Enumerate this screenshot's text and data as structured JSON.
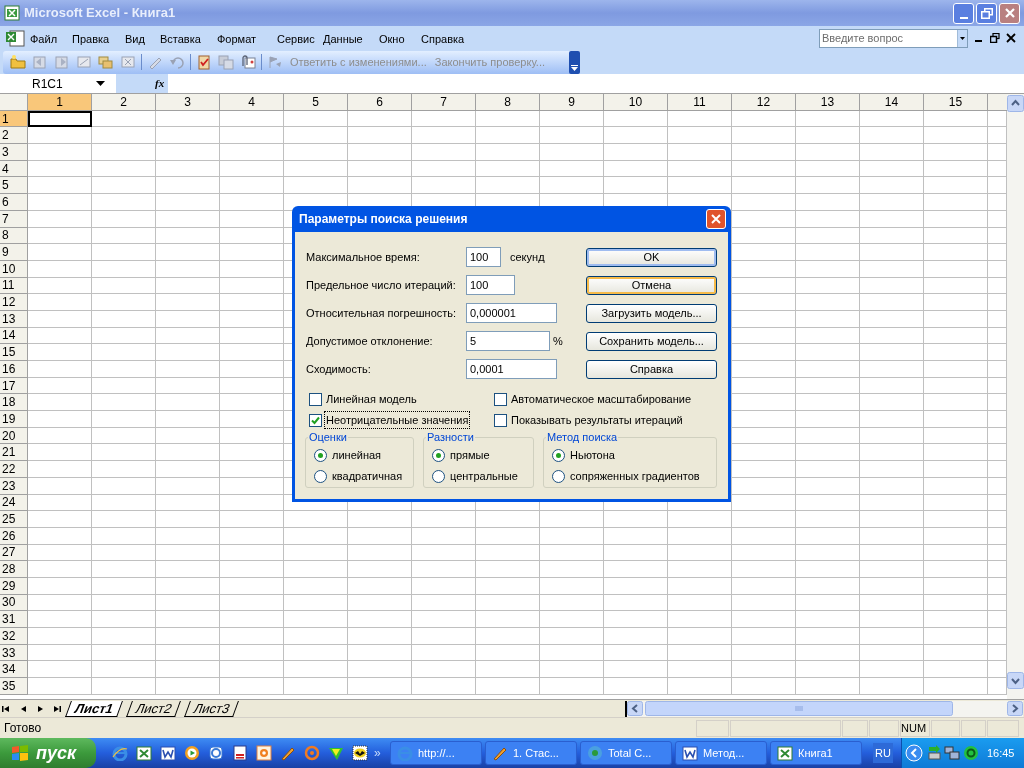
{
  "window": {
    "title": "Microsoft Excel - Книга1"
  },
  "menu": [
    "Файл",
    "Правка",
    "Вид",
    "Вставка",
    "Формат",
    "Сервис",
    "Данные",
    "Окно",
    "Справка"
  ],
  "help_search": {
    "placeholder": "Введите вопрос"
  },
  "toolbar": {
    "buttons": [
      {
        "label": "Ответить с изменениями...",
        "disabled": true
      },
      {
        "label": "Закончить проверку...",
        "disabled": true
      }
    ]
  },
  "name_box": {
    "value": "R1C1"
  },
  "formula_bar": {
    "function_label": "fx"
  },
  "columns": [
    {
      "label": "1",
      "selected": true
    },
    {
      "label": "2",
      "selected": false
    },
    {
      "label": "3",
      "selected": false
    },
    {
      "label": "4",
      "selected": false
    },
    {
      "label": "5",
      "selected": false
    },
    {
      "label": "6",
      "selected": false
    },
    {
      "label": "7",
      "selected": false
    },
    {
      "label": "8",
      "selected": false
    },
    {
      "label": "9",
      "selected": false
    },
    {
      "label": "10",
      "selected": false
    },
    {
      "label": "11",
      "selected": false
    },
    {
      "label": "12",
      "selected": false
    },
    {
      "label": "13",
      "selected": false
    },
    {
      "label": "14",
      "selected": false
    },
    {
      "label": "15",
      "selected": false
    }
  ],
  "rows": [
    {
      "label": "1",
      "selected": true
    },
    {
      "label": "2",
      "selected": false
    },
    {
      "label": "3",
      "selected": false
    },
    {
      "label": "4",
      "selected": false
    },
    {
      "label": "5",
      "selected": false
    },
    {
      "label": "6",
      "selected": false
    },
    {
      "label": "7",
      "selected": false
    },
    {
      "label": "8",
      "selected": false
    },
    {
      "label": "9",
      "selected": false
    },
    {
      "label": "10",
      "selected": false
    },
    {
      "label": "11",
      "selected": false
    },
    {
      "label": "12",
      "selected": false
    },
    {
      "label": "13",
      "selected": false
    },
    {
      "label": "14",
      "selected": false
    },
    {
      "label": "15",
      "selected": false
    },
    {
      "label": "16",
      "selected": false
    },
    {
      "label": "17",
      "selected": false
    },
    {
      "label": "18",
      "selected": false
    },
    {
      "label": "19",
      "selected": false
    },
    {
      "label": "20",
      "selected": false
    },
    {
      "label": "21",
      "selected": false
    },
    {
      "label": "22",
      "selected": false
    },
    {
      "label": "23",
      "selected": false
    },
    {
      "label": "24",
      "selected": false
    },
    {
      "label": "25",
      "selected": false
    },
    {
      "label": "26",
      "selected": false
    },
    {
      "label": "27",
      "selected": false
    },
    {
      "label": "28",
      "selected": false
    },
    {
      "label": "29",
      "selected": false
    },
    {
      "label": "30",
      "selected": false
    },
    {
      "label": "31",
      "selected": false
    },
    {
      "label": "32",
      "selected": false
    },
    {
      "label": "33",
      "selected": false
    },
    {
      "label": "34",
      "selected": false
    },
    {
      "label": "35",
      "selected": false
    }
  ],
  "dialog": {
    "title": "Параметры поиска решения",
    "fields": [
      {
        "label": "Максимальное время:",
        "value": "100",
        "unit": "секунд"
      },
      {
        "label": "Предельное число итераций:",
        "value": "100"
      },
      {
        "label": "Относительная погрешность:",
        "value": "0,000001"
      },
      {
        "label": "Допустимое отклонение:",
        "value": "5",
        "unit": "%"
      },
      {
        "label": "Сходимость:",
        "value": "0,0001"
      }
    ],
    "buttons": [
      {
        "label": "OK",
        "kind": "default"
      },
      {
        "label": "Отмена",
        "kind": "hover"
      },
      {
        "label": "Загрузить модель...",
        "kind": "normal"
      },
      {
        "label": "Сохранить модель...",
        "kind": "normal"
      },
      {
        "label": "Справка",
        "kind": "normal"
      }
    ],
    "checkboxes": [
      {
        "label": "Линейная модель",
        "checked": false,
        "focused": false
      },
      {
        "label": "Автоматическое масштабирование",
        "checked": false,
        "focused": false
      },
      {
        "label": "Неотрицательные значения",
        "checked": true,
        "focused": true
      },
      {
        "label": "Показывать результаты итераций",
        "checked": false,
        "focused": false
      }
    ],
    "groups": [
      {
        "title": "Оценки",
        "options": [
          {
            "label": "линейная",
            "selected": true
          },
          {
            "label": "квадратичная",
            "selected": false
          }
        ]
      },
      {
        "title": "Разности",
        "options": [
          {
            "label": "прямые",
            "selected": true
          },
          {
            "label": "центральные",
            "selected": false
          }
        ]
      },
      {
        "title": "Метод поиска",
        "options": [
          {
            "label": "Ньютона",
            "selected": true
          },
          {
            "label": "сопряженных градиентов",
            "selected": false
          }
        ]
      }
    ]
  },
  "sheet_tabs": [
    {
      "label": "Лист1",
      "selected": true
    },
    {
      "label": "Лист2",
      "selected": false
    },
    {
      "label": "Лист3",
      "selected": false
    }
  ],
  "status_bar": {
    "text": "Готово",
    "num_indicator": "NUM"
  },
  "taskbar": {
    "start": "пуск",
    "overflow": "»",
    "tasks": [
      {
        "label": "http://...",
        "kind": "browser"
      },
      {
        "label": "1. Стас...",
        "kind": "pen"
      },
      {
        "label": "Total C...",
        "kind": "disk"
      },
      {
        "label": "Метод...",
        "kind": "word"
      },
      {
        "label": "Книга1",
        "kind": "excel"
      }
    ],
    "language": "RU",
    "clock": "16:45"
  }
}
